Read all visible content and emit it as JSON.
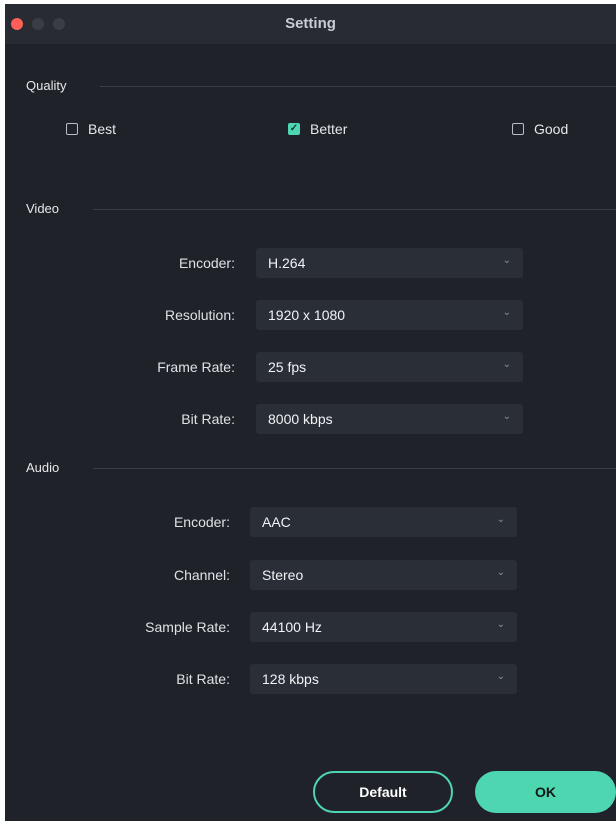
{
  "window": {
    "title": "Setting"
  },
  "quality": {
    "label": "Quality",
    "options": [
      {
        "label": "Best",
        "checked": false
      },
      {
        "label": "Better",
        "checked": true
      },
      {
        "label": "Good",
        "checked": false
      }
    ]
  },
  "video": {
    "label": "Video",
    "rows": [
      {
        "label": "Encoder:",
        "value": "H.264"
      },
      {
        "label": "Resolution:",
        "value": "1920 x 1080"
      },
      {
        "label": "Frame Rate:",
        "value": "25 fps"
      },
      {
        "label": "Bit Rate:",
        "value": "8000 kbps"
      }
    ]
  },
  "audio": {
    "label": "Audio",
    "rows": [
      {
        "label": "Encoder:",
        "value": "AAC"
      },
      {
        "label": "Channel:",
        "value": "Stereo"
      },
      {
        "label": "Sample Rate:",
        "value": "44100 Hz"
      },
      {
        "label": "Bit Rate:",
        "value": "128 kbps"
      }
    ]
  },
  "buttons": {
    "default": "Default",
    "ok": "OK"
  },
  "icons": {
    "chevron": "chevron-down-icon",
    "check": "checkmark-icon"
  },
  "colors": {
    "accent": "#4ed6b1",
    "background": "#1f2229",
    "field": "#2a2e36",
    "close": "#ff5f57"
  }
}
